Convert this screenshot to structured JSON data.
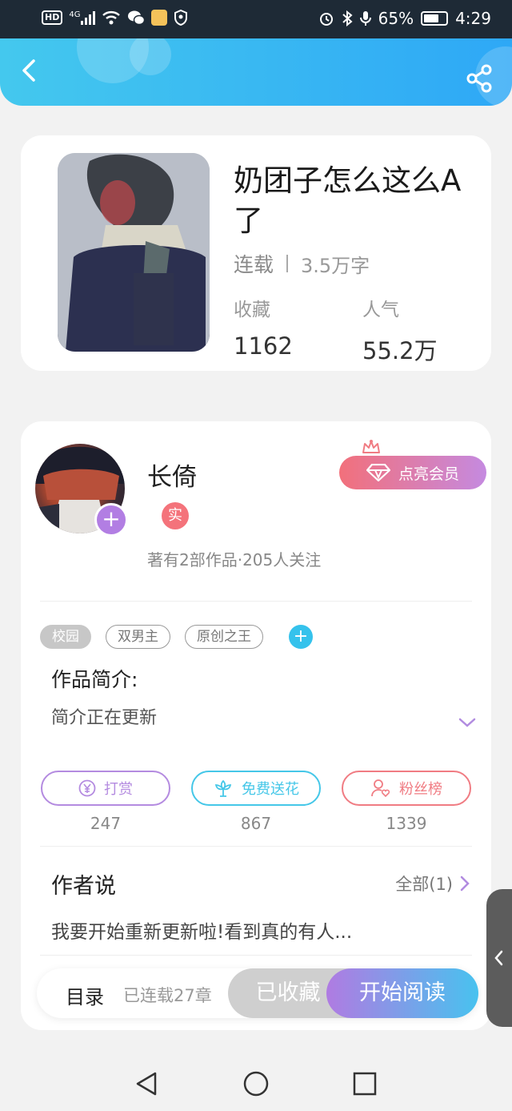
{
  "status_bar": {
    "network": "HD",
    "signal": "4G",
    "battery": "65%",
    "time": "4:29"
  },
  "header": {
    "back_icon": "chevron-left-icon",
    "share_icon": "share-icon"
  },
  "book": {
    "title": "奶团子怎么这么A了",
    "status": "连载",
    "word_count": "3.5万字",
    "stats": [
      {
        "label": "收藏",
        "value": "1162"
      },
      {
        "label": "人气",
        "value": "55.2万"
      }
    ]
  },
  "author": {
    "name": "长倚",
    "verified_badge": "实",
    "stats_text": "著有2部作品·205人关注",
    "vip_button": "点亮会员"
  },
  "tags": [
    {
      "label": "校园",
      "filled": true
    },
    {
      "label": "双男主",
      "filled": false
    },
    {
      "label": "原创之王",
      "filled": false
    }
  ],
  "intro": {
    "title": "作品简介:",
    "text": "简介正在更新"
  },
  "actions": [
    {
      "label": "打赏",
      "count": "247",
      "color": "#b48be0",
      "icon": "yen-coin-icon"
    },
    {
      "label": "免费送花",
      "count": "867",
      "color": "#45c7e8",
      "icon": "flower-icon"
    },
    {
      "label": "粉丝榜",
      "count": "1339",
      "color": "#f07c83",
      "icon": "fan-user-icon"
    }
  ],
  "author_says": {
    "title": "作者说",
    "all_label": "全部(1)",
    "text": "我要开始重新更新啦!看到真的有人..."
  },
  "bottom_bar": {
    "toc_label": "目录",
    "toc_count": "已连载27章",
    "collected_label": "已收藏",
    "read_label": "开始阅读"
  },
  "colors": {
    "header_gradient_start": "#44c8ee",
    "header_gradient_end": "#2ea8f6",
    "vip_start": "#f2707b",
    "vip_end": "#c58ae0",
    "read_start": "#b07be2",
    "read_end": "#48c2ef"
  }
}
